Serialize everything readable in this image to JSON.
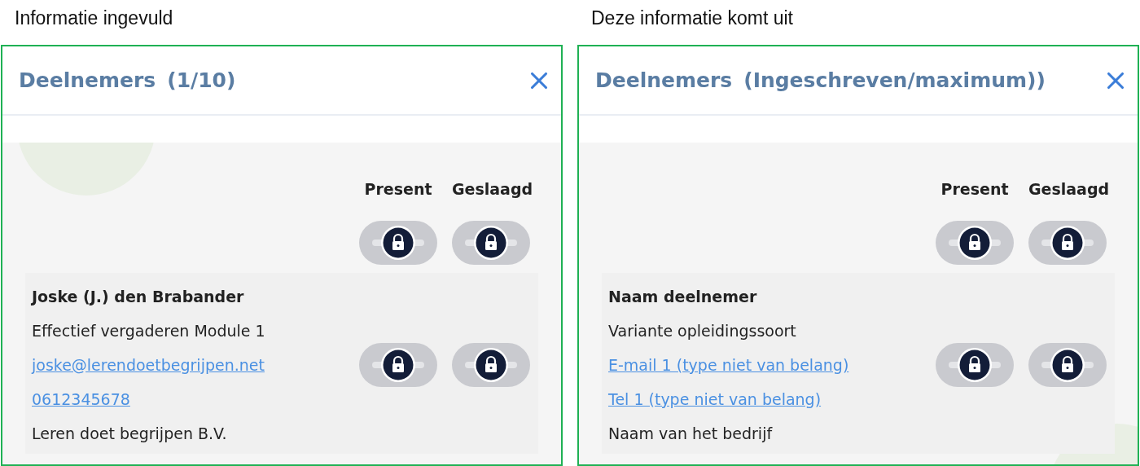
{
  "panels": [
    {
      "caption": "Informatie ingevuld",
      "title": "Deelnemers",
      "count": "(1/10)",
      "columns": [
        "Present",
        "Geslaagd"
      ],
      "header_toggles": [
        {
          "disabled": true
        },
        {
          "disabled": true
        }
      ],
      "participant": [
        {
          "kind": "name",
          "text": "Joske (J.) den Brabander"
        },
        {
          "kind": "text",
          "text": "Effectief vergaderen Module 1"
        },
        {
          "kind": "link",
          "text": "joske@lerendoetbegrijpen.net"
        },
        {
          "kind": "link",
          "text": "0612345678"
        },
        {
          "kind": "text",
          "text": "Leren doet begrijpen B.V."
        }
      ],
      "row_toggles": [
        {
          "disabled": true
        },
        {
          "disabled": true
        }
      ]
    },
    {
      "caption": "Deze informatie komt uit",
      "title": "Deelnemers",
      "count": "(Ingeschreven/maximum))",
      "columns": [
        "Present",
        "Geslaagd"
      ],
      "header_toggles": [
        {
          "disabled": true
        },
        {
          "disabled": true
        }
      ],
      "participant": [
        {
          "kind": "name",
          "text": "Naam deelnemer"
        },
        {
          "kind": "text",
          "text": "Variante opleidingssoort"
        },
        {
          "kind": "link",
          "text": "E-mail 1 (type niet van belang)"
        },
        {
          "kind": "link",
          "text": "Tel 1 (type niet van belang)"
        },
        {
          "kind": "text",
          "text": "Naam van het bedrijf"
        }
      ],
      "row_toggles": [
        {
          "disabled": true
        },
        {
          "disabled": true
        }
      ]
    }
  ]
}
